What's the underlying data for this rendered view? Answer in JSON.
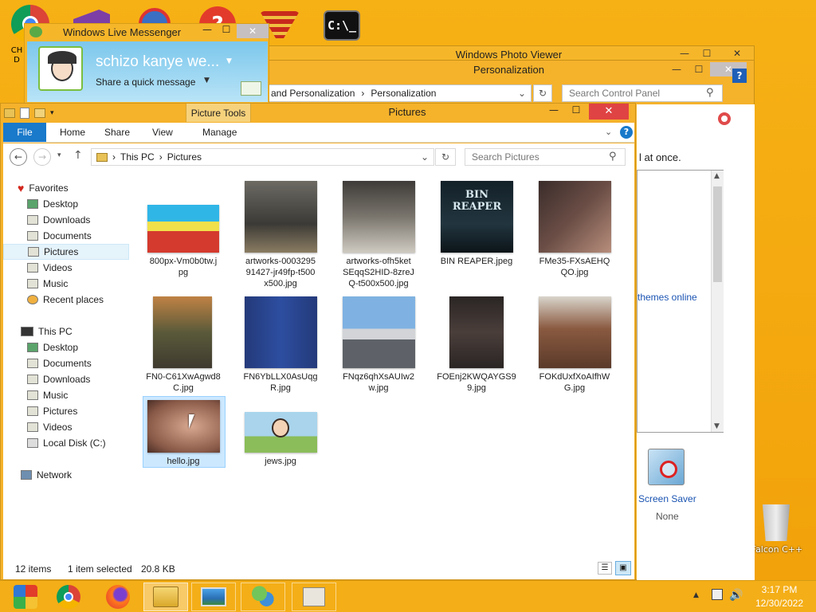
{
  "desktop": {
    "icons": [
      {
        "name": "chrome-desktop-icon",
        "label": "CH D"
      },
      {
        "name": "visual-studio-desktop-icon",
        "label": ""
      },
      {
        "name": "app-shield-desktop-icon",
        "label": ""
      },
      {
        "name": "help-desktop-icon",
        "label": "?"
      },
      {
        "name": "flag-desktop-icon",
        "label": ""
      },
      {
        "name": "cmd-desktop-icon",
        "label": "C:\\_"
      }
    ],
    "recycle_label": "Falcon C++"
  },
  "messenger": {
    "title": "Windows Live Messenger",
    "username": "schizo kanye we...",
    "status_prompt": "Share a quick message"
  },
  "photo_viewer": {
    "title": "Windows Photo Viewer"
  },
  "control_panel": {
    "title": "Personalization",
    "breadcrumb": [
      "and Personalization",
      "Personalization"
    ],
    "search_placeholder": "Search Control Panel",
    "text_at_once": "l at once.",
    "themes_online": "themes online",
    "screen_saver_label": "Screen Saver",
    "screen_saver_value": "None"
  },
  "explorer": {
    "title": "Pictures",
    "contextual_tab": "Picture Tools",
    "tabs": [
      "File",
      "Home",
      "Share",
      "View",
      "Manage"
    ],
    "address": [
      "This PC",
      "Pictures"
    ],
    "search_placeholder": "Search Pictures",
    "nav": {
      "favorites": {
        "label": "Favorites",
        "items": [
          "Desktop",
          "Downloads",
          "Documents",
          "Pictures",
          "Videos",
          "Music",
          "Recent places"
        ]
      },
      "thispc": {
        "label": "This PC",
        "items": [
          "Desktop",
          "Documents",
          "Downloads",
          "Music",
          "Pictures",
          "Videos",
          "Local Disk (C:)"
        ]
      },
      "network": "Network"
    },
    "files": [
      {
        "l1": "800px-Vm0b0tw.j",
        "l2": "pg",
        "l3": ""
      },
      {
        "l1": "artworks-0003295",
        "l2": "91427-jr49fp-t500",
        "l3": "x500.jpg"
      },
      {
        "l1": "artworks-ofh5ket",
        "l2": "SEqqS2HID-8zreJ",
        "l3": "Q-t500x500.jpg"
      },
      {
        "l1": "BIN REAPER.jpeg",
        "l2": "",
        "l3": ""
      },
      {
        "l1": "FMe35-FXsAEHQ",
        "l2": "QO.jpg",
        "l3": ""
      },
      {
        "l1": "FN0-C61XwAgwd8",
        "l2": "C.jpg",
        "l3": ""
      },
      {
        "l1": "FN6YbLLX0AsUqg",
        "l2": "R.jpg",
        "l3": ""
      },
      {
        "l1": "FNqz6qhXsAUIw2",
        "l2": "w.jpg",
        "l3": ""
      },
      {
        "l1": "FOEnj2KWQAYGS9",
        "l2": "9.jpg",
        "l3": ""
      },
      {
        "l1": "FOKdUxfXoAIfhW",
        "l2": "G.jpg",
        "l3": ""
      },
      {
        "l1": "hello.jpg",
        "l2": "",
        "l3": ""
      },
      {
        "l1": "jews.jpg",
        "l2": "",
        "l3": ""
      }
    ],
    "bin_reaper_art_text": "BIN REAPER",
    "status_items": "12 items",
    "status_selected": "1 item selected",
    "status_size": "20.8 KB"
  },
  "taskbar": {
    "time": "3:17 PM",
    "date": "12/30/2022"
  }
}
